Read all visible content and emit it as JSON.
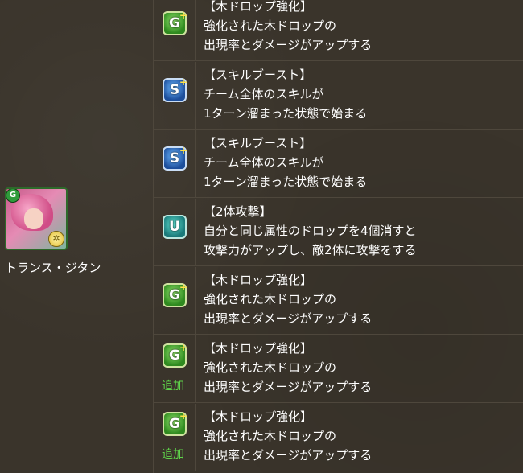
{
  "character": {
    "name": "トランス・ジタン",
    "attribute_badge": "G",
    "portrait_icon": "character-portrait"
  },
  "colors": {
    "background": "#3a342b",
    "grid_line": "#4e473c",
    "added_label": "#5fd34a"
  },
  "awakenings": [
    {
      "icon": "wood-drop-enhance-icon",
      "color": "green",
      "glyph": "G",
      "title": "【木ドロップ強化】",
      "line1": "強化された木ドロップの",
      "line2": "出現率とダメージがアップする",
      "added": ""
    },
    {
      "icon": "skill-boost-icon",
      "color": "blue",
      "glyph": "S",
      "title": "【スキルブースト】",
      "line1": "チーム全体のスキルが",
      "line2": "1ターン溜まった状態で始まる",
      "added": ""
    },
    {
      "icon": "skill-boost-icon",
      "color": "blue",
      "glyph": "S",
      "title": "【スキルブースト】",
      "line1": "チーム全体のスキルが",
      "line2": "1ターン溜まった状態で始まる",
      "added": ""
    },
    {
      "icon": "two-pronged-attack-icon",
      "color": "teal",
      "glyph": "U",
      "title": "【2体攻撃】",
      "line1": "自分と同じ属性のドロップを4個消すと",
      "line2": "攻撃力がアップし、敵2体に攻撃をする",
      "added": ""
    },
    {
      "icon": "wood-drop-enhance-icon",
      "color": "green",
      "glyph": "G",
      "title": "【木ドロップ強化】",
      "line1": "強化された木ドロップの",
      "line2": "出現率とダメージがアップする",
      "added": ""
    },
    {
      "icon": "wood-drop-enhance-icon",
      "color": "green",
      "glyph": "G",
      "title": "【木ドロップ強化】",
      "line1": "強化された木ドロップの",
      "line2": "出現率とダメージがアップする",
      "added": "追加"
    },
    {
      "icon": "wood-drop-enhance-icon",
      "color": "green",
      "glyph": "G",
      "title": "【木ドロップ強化】",
      "line1": "強化された木ドロップの",
      "line2": "出現率とダメージがアップする",
      "added": "追加"
    }
  ]
}
